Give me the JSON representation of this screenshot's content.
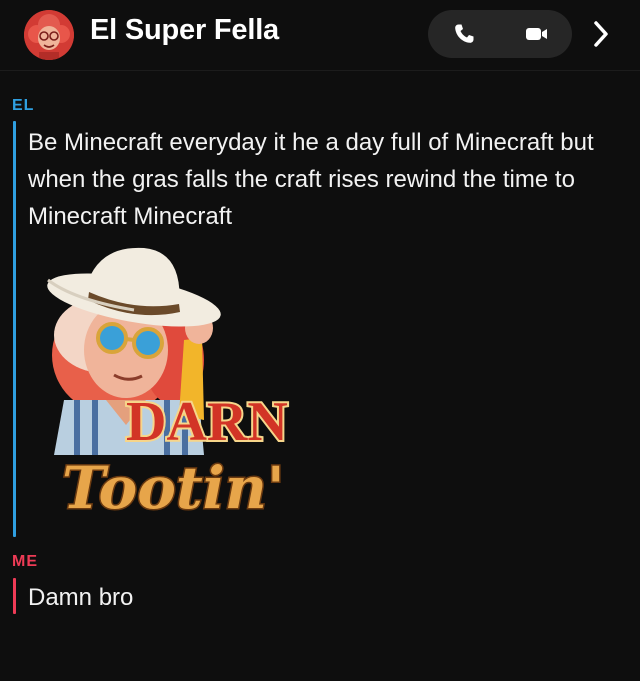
{
  "header": {
    "title": "El Super Fella",
    "avatar_icon": "bitmoji-avatar-icon",
    "phone_icon": "phone-icon",
    "video_icon": "video-camera-icon",
    "more_icon": "chevron-right-icon"
  },
  "messages": [
    {
      "sender": "EL",
      "color": "#2f9fe0",
      "text": "Be Minecraft everyday it he a day full of Minecraft but when the gras falls the craft rises rewind the time to Minecraft Minecraft",
      "sticker": {
        "line1": "DARN",
        "line2": "Tootin'"
      }
    },
    {
      "sender": "ME",
      "color": "#ee3b56",
      "text": "Damn bro"
    }
  ]
}
